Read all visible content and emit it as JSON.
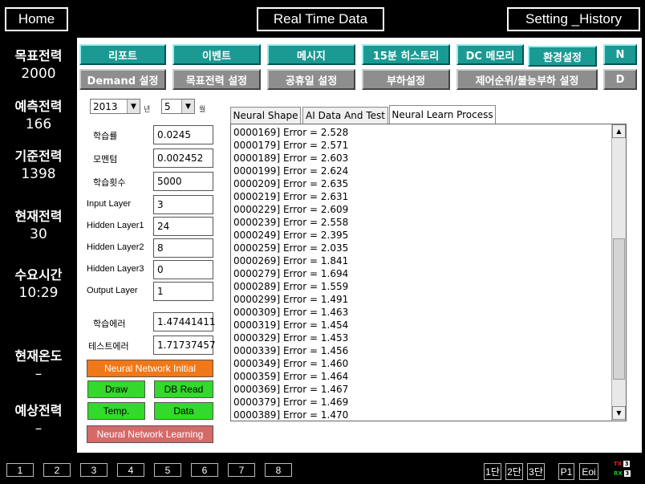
{
  "header": {
    "home": "Home",
    "title": "Real Time Data",
    "setting": "Setting _History"
  },
  "stats": [
    {
      "label": "목표전력",
      "value": "2000"
    },
    {
      "label": "예측전력",
      "value": "166"
    },
    {
      "label": "기준전력",
      "value": "1398"
    },
    {
      "label": "현재전력",
      "value": "30"
    },
    {
      "label": "수요시간",
      "value": "10:29"
    },
    {
      "label": "현재온도",
      "value": "–"
    },
    {
      "label": "예상전력",
      "value": "–"
    }
  ],
  "toolbar": {
    "row1": [
      "리포트",
      "이벤트",
      "메시지",
      "15분 히스토리",
      "DC 메모리",
      "환경설정",
      "N"
    ],
    "row2": [
      "Demand 설정",
      "목표전력 설정",
      "공휴일 설정",
      "부하설정",
      "제어순위/불능부하 설정",
      "D"
    ]
  },
  "form": {
    "year": "2013",
    "year_unit": "년",
    "month": "5",
    "month_unit": "월",
    "fields": [
      {
        "label": "학습률",
        "value": "0.0245"
      },
      {
        "label": "모멘텀",
        "value": "0.002452"
      },
      {
        "label": "학습횟수",
        "value": "5000"
      },
      {
        "label": "Input Layer",
        "value": "3"
      },
      {
        "label": "Hidden Layer1",
        "value": "24"
      },
      {
        "label": "Hidden Layer2",
        "value": "8"
      },
      {
        "label": "Hidden Layer3",
        "value": "0"
      },
      {
        "label": "Output Layer",
        "value": "1"
      },
      {
        "label": "학습에러",
        "value": "1.47441411"
      },
      {
        "label": "테스트에러",
        "value": "1.71737457"
      }
    ],
    "buttons": {
      "init": "Neural Network Initial",
      "draw": "Draw",
      "db_read": "DB Read",
      "temp": "Temp.",
      "data": "Data",
      "learn": "Neural Network Learning"
    }
  },
  "tabs": [
    "Neural Shape",
    "AI Data And Test",
    "Neural Learn Process"
  ],
  "log": [
    "0000169] Error = 2.528",
    "0000179] Error = 2.571",
    "0000189] Error = 2.603",
    "0000199] Error = 2.624",
    "0000209] Error = 2.635",
    "0000219] Error = 2.631",
    "0000229] Error = 2.609",
    "0000239] Error = 2.558",
    "0000249] Error = 2.395",
    "0000259] Error = 2.035",
    "0000269] Error = 1.841",
    "0000279] Error = 1.694",
    "0000289] Error = 1.559",
    "0000299] Error = 1.491",
    "0000309] Error = 1.463",
    "0000319] Error = 1.454",
    "0000329] Error = 1.453",
    "0000339] Error = 1.456",
    "0000349] Error = 1.460",
    "0000359] Error = 1.464",
    "0000369] Error = 1.467",
    "0000379] Error = 1.469",
    "0000389] Error = 1.470"
  ],
  "bottom": {
    "numbers": [
      "1",
      "2",
      "3",
      "4",
      "5",
      "6",
      "7",
      "8"
    ],
    "stages": [
      "1단",
      "2단",
      "3단"
    ],
    "p1": "P1",
    "eoi": "Eoi",
    "tx": "TX",
    "rx": "RX",
    "tx_val": "3",
    "rx_val": "3"
  },
  "colors": {
    "teal": "#1a9a93",
    "gray": "#8e8e8e",
    "orange": "#f07818",
    "green": "#33d92b",
    "learn_red": "#d56a69",
    "tx_red": "#e02020",
    "rx_green": "#20c020"
  }
}
